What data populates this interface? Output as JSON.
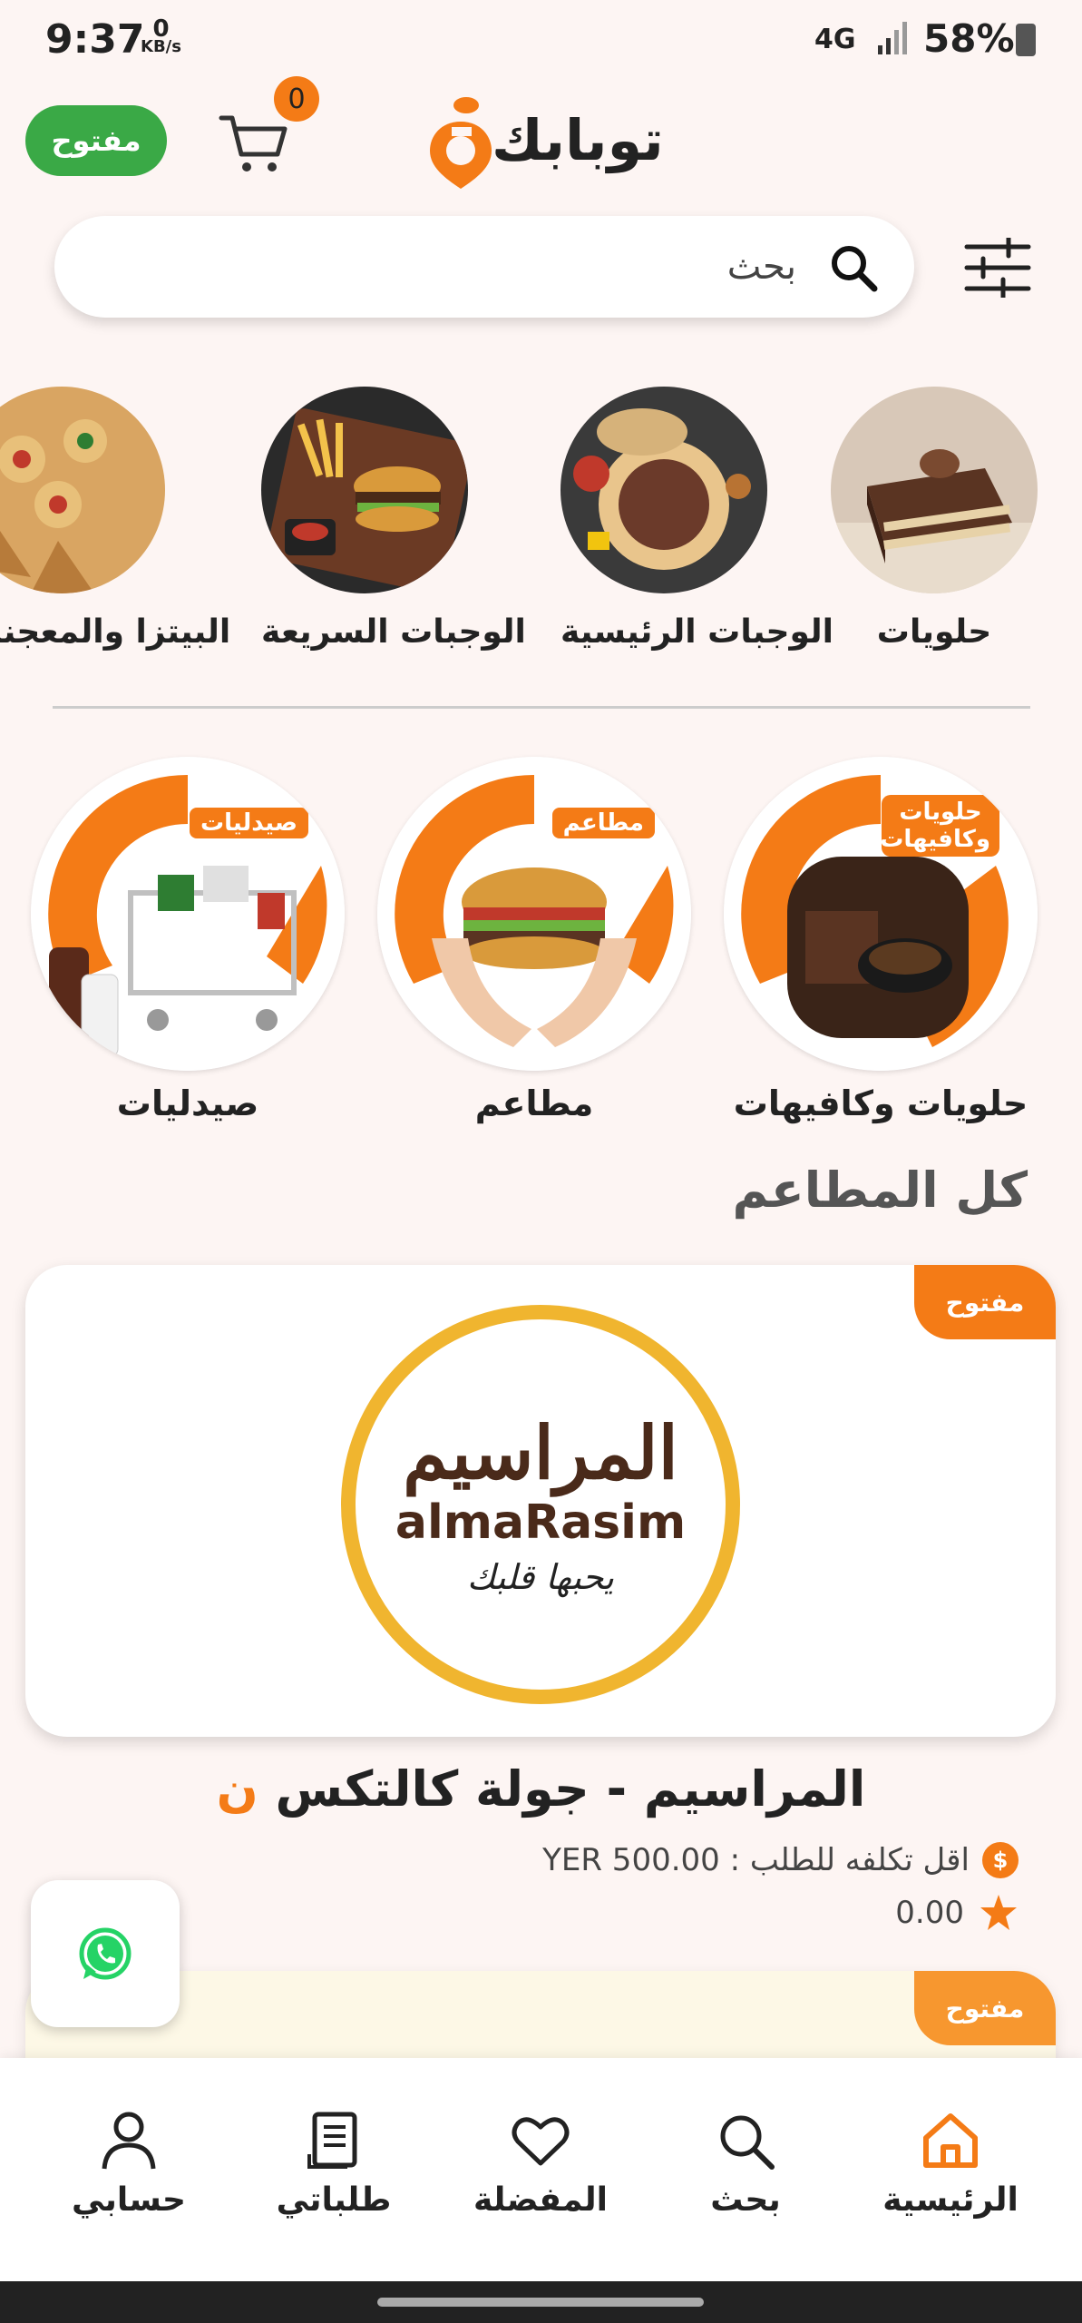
{
  "status_bar": {
    "time": "9:37",
    "data_speed_value": "0",
    "data_speed_unit": "KB/s",
    "network": "4G",
    "battery": "58%"
  },
  "header": {
    "open_status": "مفتوح",
    "cart_count": "0",
    "logo_text": "توبابك"
  },
  "search": {
    "placeholder": "بحث"
  },
  "categories": [
    {
      "label": "حلويات",
      "icon": "cake-photo"
    },
    {
      "label": "الوجبات الرئيسية",
      "icon": "main-dish-photo"
    },
    {
      "label": "الوجبات السريعة",
      "icon": "burger-fries-photo"
    },
    {
      "label": "البيتزا والمعجنات",
      "icon": "pizza-pastry-photo"
    }
  ],
  "services": [
    {
      "label": "حلويات وكافيهات",
      "banner": "حلويات وكافيهات"
    },
    {
      "label": "مطاعم",
      "banner": "مطاعم"
    },
    {
      "label": "صيدليات",
      "banner": "صيدليات"
    }
  ],
  "section_title": "كل المطاعم",
  "restaurants": [
    {
      "status": "مفتوح",
      "name": "المراسيم - جولة كالتكس",
      "min_order_label": "اقل تكلفه للطلب : YER 500.00",
      "rating": "0.00",
      "logo_latin": "almaRasim",
      "logo_arabic": "المراسيم",
      "logo_slogan": "يحبها قلبك"
    },
    {
      "status": "مفتوح"
    }
  ],
  "bottom_nav": [
    {
      "label": "الرئيسية",
      "icon": "home-icon",
      "active": true
    },
    {
      "label": "بحث",
      "icon": "search-icon"
    },
    {
      "label": "المفضلة",
      "icon": "heart-icon"
    },
    {
      "label": "طلباتي",
      "icon": "orders-icon"
    },
    {
      "label": "حسابي",
      "icon": "profile-icon"
    }
  ],
  "colors": {
    "brand_orange": "#f47b16",
    "open_green": "#3aa946",
    "background": "#fdf5f3"
  }
}
